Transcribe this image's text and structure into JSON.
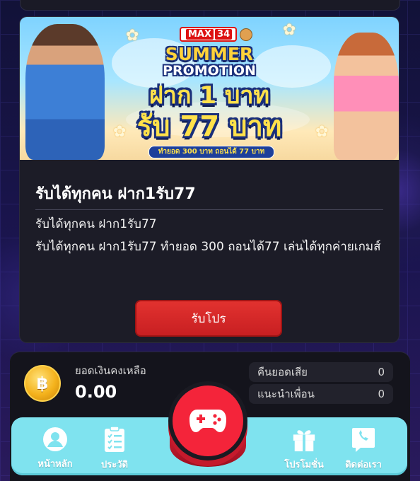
{
  "banner": {
    "logo_text": "MAX",
    "logo_number": "34",
    "summer": "SUMMER",
    "promotion": "PROMOTION",
    "headline_line1": "ฝาก 1 บาท",
    "headline_line2": "รับ 77 บาท",
    "condition": "ทำยอด 300 บาท ถอนได้ 77 บาท"
  },
  "card": {
    "title": "รับได้ทุกคน ฝาก1รับ77",
    "body_line1": "รับได้ทุกคน ฝาก1รับ77",
    "body_line2": "รับได้ทุกคน ฝาก1รับ77 ทำยอด 300 ถอนได้77 เล่นได้ทุกค่ายเกมส์",
    "button_label": "รับโปร",
    "button_color": "#d8282b"
  },
  "wallet": {
    "coin_symbol": "฿",
    "balance_label": "ยอดเงินคงเหลือ",
    "balance_value": "0.00",
    "stats": [
      {
        "label": "คืนยอดเสีย",
        "value": "0"
      },
      {
        "label": "แนะนำเพื่อน",
        "value": "0"
      }
    ]
  },
  "nav": {
    "items": [
      {
        "label": "หน้าหลัก",
        "icon": "user-icon"
      },
      {
        "label": "ประวัติ",
        "icon": "clipboard-icon"
      },
      {
        "label": "โปรโมชั่น",
        "icon": "gift-icon"
      },
      {
        "label": "ติดต่อเรา",
        "icon": "phone-chat-icon"
      }
    ],
    "center_icon": "gamepad-icon",
    "accent_color": "#7fe3ef"
  }
}
